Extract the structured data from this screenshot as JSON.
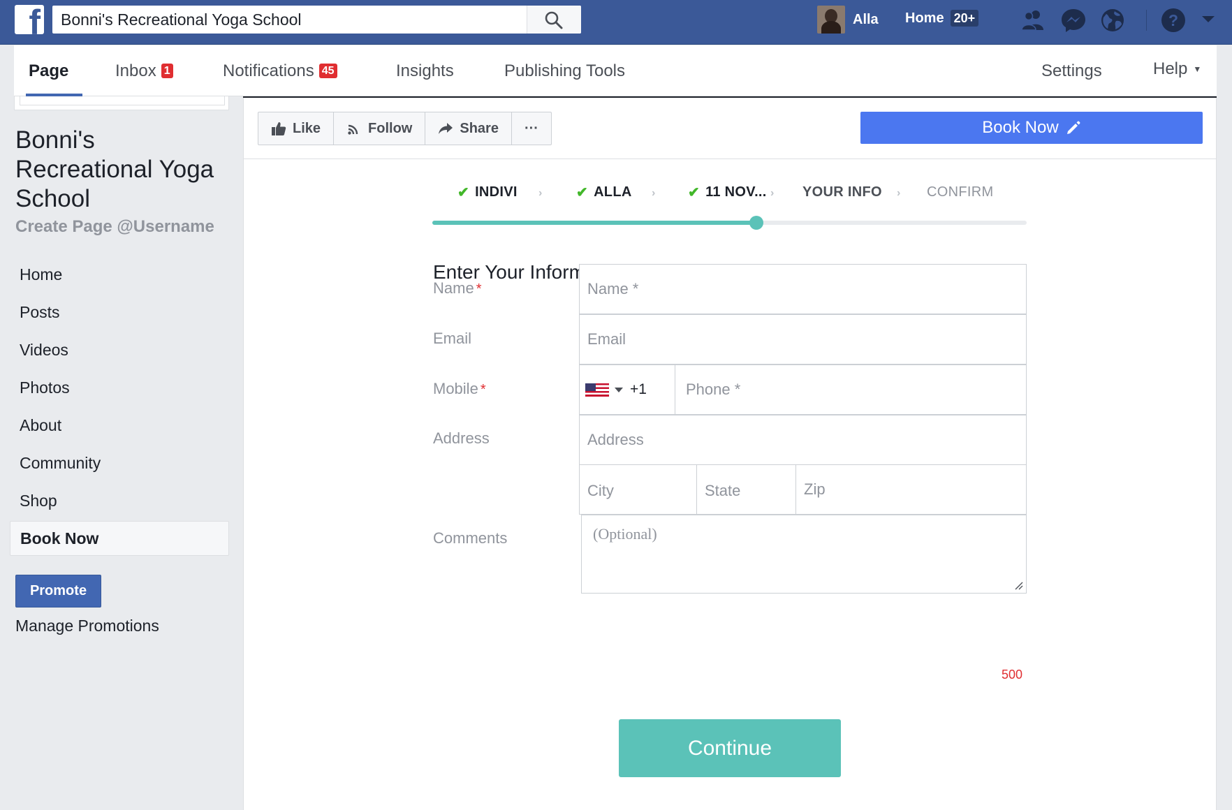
{
  "topbar": {
    "logo_letter": "f",
    "search_value": "Bonni's Recreational Yoga School",
    "user_name": "Alla",
    "home_label": "Home",
    "home_count": "20+",
    "icons": [
      "friends-icon",
      "messenger-icon",
      "globe-icon",
      "help-icon",
      "caret-down-icon"
    ]
  },
  "pagenav": {
    "tabs": [
      {
        "label": "Page"
      },
      {
        "label": "Inbox",
        "badge": "1"
      },
      {
        "label": "Notifications",
        "badge": "45"
      },
      {
        "label": "Insights"
      },
      {
        "label": "Publishing Tools"
      }
    ],
    "settings_label": "Settings",
    "help_label": "Help",
    "help_caret": "▼"
  },
  "sidebar": {
    "page_name": "Bonni's Recreational Yoga School",
    "username_link": "Create Page @Username",
    "items": [
      {
        "label": "Home"
      },
      {
        "label": "Posts"
      },
      {
        "label": "Videos"
      },
      {
        "label": "Photos"
      },
      {
        "label": "About"
      },
      {
        "label": "Community"
      },
      {
        "label": "Shop"
      },
      {
        "label": "Book Now"
      }
    ],
    "promote_label": "Promote",
    "manage_promotions_label": "Manage Promotions"
  },
  "actions": {
    "like_label": "Like",
    "follow_label": "Follow",
    "share_label": "Share",
    "more_label": "···",
    "book_now_label": "Book Now"
  },
  "wizard": {
    "steps": [
      {
        "label": "INDIVI",
        "check": "✔"
      },
      {
        "label": "ALLA",
        "check": "✔"
      },
      {
        "label": "11 NOV...",
        "check": "✔"
      },
      {
        "label": "YOUR INFO"
      },
      {
        "label": "CONFIRM"
      }
    ],
    "separator": "›",
    "progress_fraction": 0.545
  },
  "form": {
    "title": "Enter Your Information",
    "required_mark": "*",
    "name_label": "Name",
    "name_placeholder": "Name *",
    "email_label": "Email",
    "email_placeholder": "Email",
    "mobile_label": "Mobile",
    "country_code": "+1",
    "phone_placeholder": "Phone *",
    "address_label": "Address",
    "address_placeholder": "Address",
    "city_placeholder": "City",
    "state_placeholder": "State",
    "zip_placeholder": "Zip",
    "comments_label": "Comments",
    "comments_placeholder": "(Optional)",
    "char_remaining": "500",
    "continue_label": "Continue"
  },
  "colors": {
    "facebook_blue": "#3b5998",
    "book_now_blue": "#4b77f0",
    "teal_accent": "#5bc2b8",
    "required_red": "#e02e31",
    "check_green": "#42b72a"
  }
}
